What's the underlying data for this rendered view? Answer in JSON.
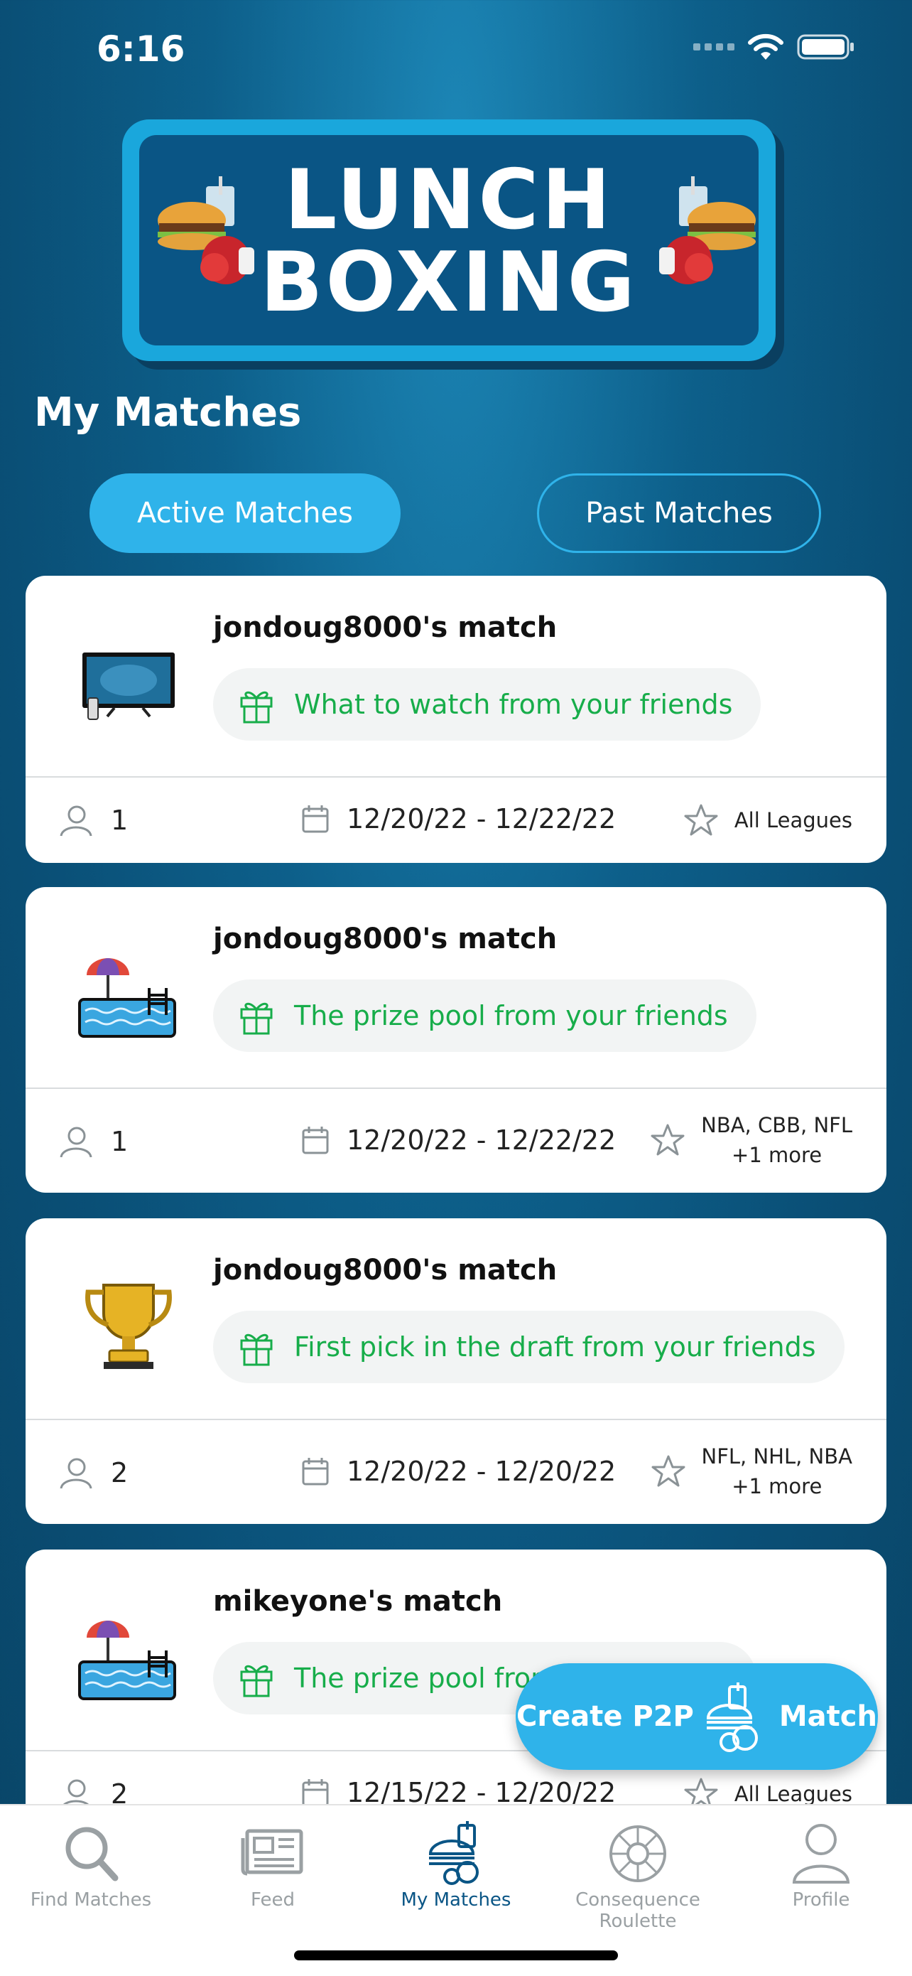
{
  "status_bar": {
    "time": "6:16"
  },
  "logo": {
    "line1": "LUNCH",
    "line2": "BOXING"
  },
  "header": {
    "title": "My Matches"
  },
  "segments": {
    "active_label": "Active Matches",
    "inactive_label": "Past Matches"
  },
  "matches": [
    {
      "title": "jondoug8000's match",
      "prize": "What to watch from your friends",
      "icon": "tv-icon",
      "players": "1",
      "dates": "12/20/22 - 12/22/22",
      "leagues_line1": "All Leagues",
      "leagues_line2": ""
    },
    {
      "title": "jondoug8000's match",
      "prize": "The prize pool from your friends",
      "icon": "pool-icon",
      "players": "1",
      "dates": "12/20/22 - 12/22/22",
      "leagues_line1": "NBA, CBB, NFL",
      "leagues_line2": "+1 more"
    },
    {
      "title": "jondoug8000's match",
      "prize": "First pick in the draft from your friends",
      "icon": "trophy-icon",
      "players": "2",
      "dates": "12/20/22 - 12/20/22",
      "leagues_line1": "NFL, NHL, NBA",
      "leagues_line2": "+1 more"
    },
    {
      "title": "mikeyone's match",
      "prize": "The prize pool from your friends",
      "icon": "pool-icon",
      "players": "2",
      "dates": "12/15/22 - 12/20/22",
      "leagues_line1": "All Leagues",
      "leagues_line2": ""
    }
  ],
  "fab": {
    "left_label": "Create P2P",
    "right_label": "Match"
  },
  "tabs": [
    {
      "label": "Find Matches",
      "icon": "search-icon"
    },
    {
      "label": "Feed",
      "icon": "newspaper-icon"
    },
    {
      "label": "My Matches",
      "icon": "lunch-icon"
    },
    {
      "label": "Consequence Roulette",
      "icon": "roulette-icon"
    },
    {
      "label": "Profile",
      "icon": "profile-icon"
    }
  ],
  "colors": {
    "accent": "#2fb3ea",
    "background": "#0a5585",
    "prize_green": "#17ad4a",
    "active_tab": "#0a5585"
  }
}
